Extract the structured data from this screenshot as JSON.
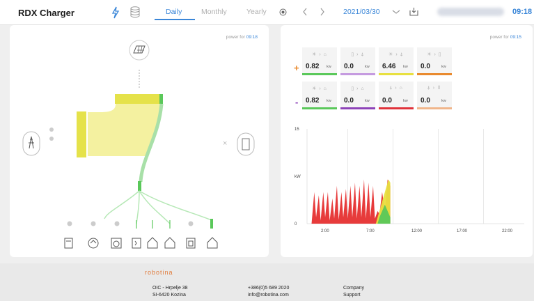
{
  "header": {
    "title": "RDX Charger",
    "tabs": [
      {
        "label": "Daily",
        "active": true
      },
      {
        "label": "Monthly",
        "active": false
      },
      {
        "label": "Yearly",
        "active": false
      }
    ],
    "date": "2021/03/30",
    "time": "09:18"
  },
  "left_panel": {
    "power_for_label": "power for",
    "power_for_time": "09:18"
  },
  "right_panel": {
    "power_for_label": "power for",
    "power_for_time": "09:15",
    "plus_sign": "+",
    "minus_sign": "-",
    "positive": [
      {
        "value": "0.82",
        "unit": "kw",
        "color": "#5ac85a"
      },
      {
        "value": "0.0",
        "unit": "kw",
        "color": "#c59be0"
      },
      {
        "value": "6.46",
        "unit": "kw",
        "color": "#e8e040"
      },
      {
        "value": "0.0",
        "unit": "kw",
        "color": "#e98a2e"
      }
    ],
    "negative": [
      {
        "value": "0.82",
        "unit": "kw",
        "color": "#5ac85a"
      },
      {
        "value": "0.0",
        "unit": "kw",
        "color": "#8d43b8"
      },
      {
        "value": "0.0",
        "unit": "kw",
        "color": "#e0323a"
      },
      {
        "value": "0.0",
        "unit": "kw",
        "color": "#f0b58a"
      }
    ]
  },
  "chart_data": {
    "type": "area",
    "ylabel": "kW",
    "ylim": [
      0,
      15
    ],
    "y_ticks": [
      "15",
      "kW",
      "0"
    ],
    "x_ticks": [
      "2:00",
      "7:00",
      "12:00",
      "17:00",
      "22:00"
    ],
    "grid": true,
    "series": [
      {
        "color": "#e63030",
        "x": [
          0.5,
          0.8,
          1.0,
          1.3,
          1.5,
          1.8,
          2.0,
          2.3,
          2.5,
          2.8,
          3.0,
          3.3,
          3.5,
          3.8,
          4.0,
          4.3,
          4.5,
          4.8,
          5.0,
          5.3,
          5.5,
          5.8,
          6.0,
          6.3,
          6.5,
          6.8,
          7.0,
          7.3,
          7.5,
          7.8,
          8.0,
          8.3,
          8.6,
          8.9,
          9.2
        ],
        "values": [
          0,
          5,
          1,
          4.5,
          0.5,
          5,
          1,
          5,
          0.5,
          4,
          0.8,
          6,
          0.6,
          5,
          1,
          5.5,
          0.8,
          6,
          1,
          6.5,
          0.8,
          6,
          1,
          7,
          0.8,
          6.5,
          1,
          6,
          0.8,
          2,
          1.5,
          5,
          2,
          7,
          6
        ]
      },
      {
        "color": "#e8e040",
        "x": [
          7.6,
          7.8,
          8.0,
          8.2,
          8.4,
          8.6,
          8.8,
          9.0,
          9.2
        ],
        "values": [
          0,
          1,
          2,
          3,
          4,
          5,
          6,
          7,
          6.5
        ]
      },
      {
        "color": "#5ac85a",
        "x": [
          7.8,
          8.0,
          8.3,
          8.6,
          8.9,
          9.2
        ],
        "values": [
          0,
          1,
          2,
          3,
          2,
          1
        ]
      }
    ]
  },
  "footer": {
    "logo": "robotina",
    "address": [
      "OIC - Hrpelje 38",
      "SI-6420 Kozina"
    ],
    "contact": [
      "+386(0)5 689 2020",
      "info@robotina.com"
    ],
    "links": [
      "Company",
      "Support"
    ]
  },
  "icons": {
    "lightning": "lightning-icon",
    "database": "database-icon",
    "settings": "target-icon",
    "prev": "chevron-left-icon",
    "next": "chevron-right-icon",
    "dropdown": "chevron-down-icon",
    "export": "download-icon"
  }
}
